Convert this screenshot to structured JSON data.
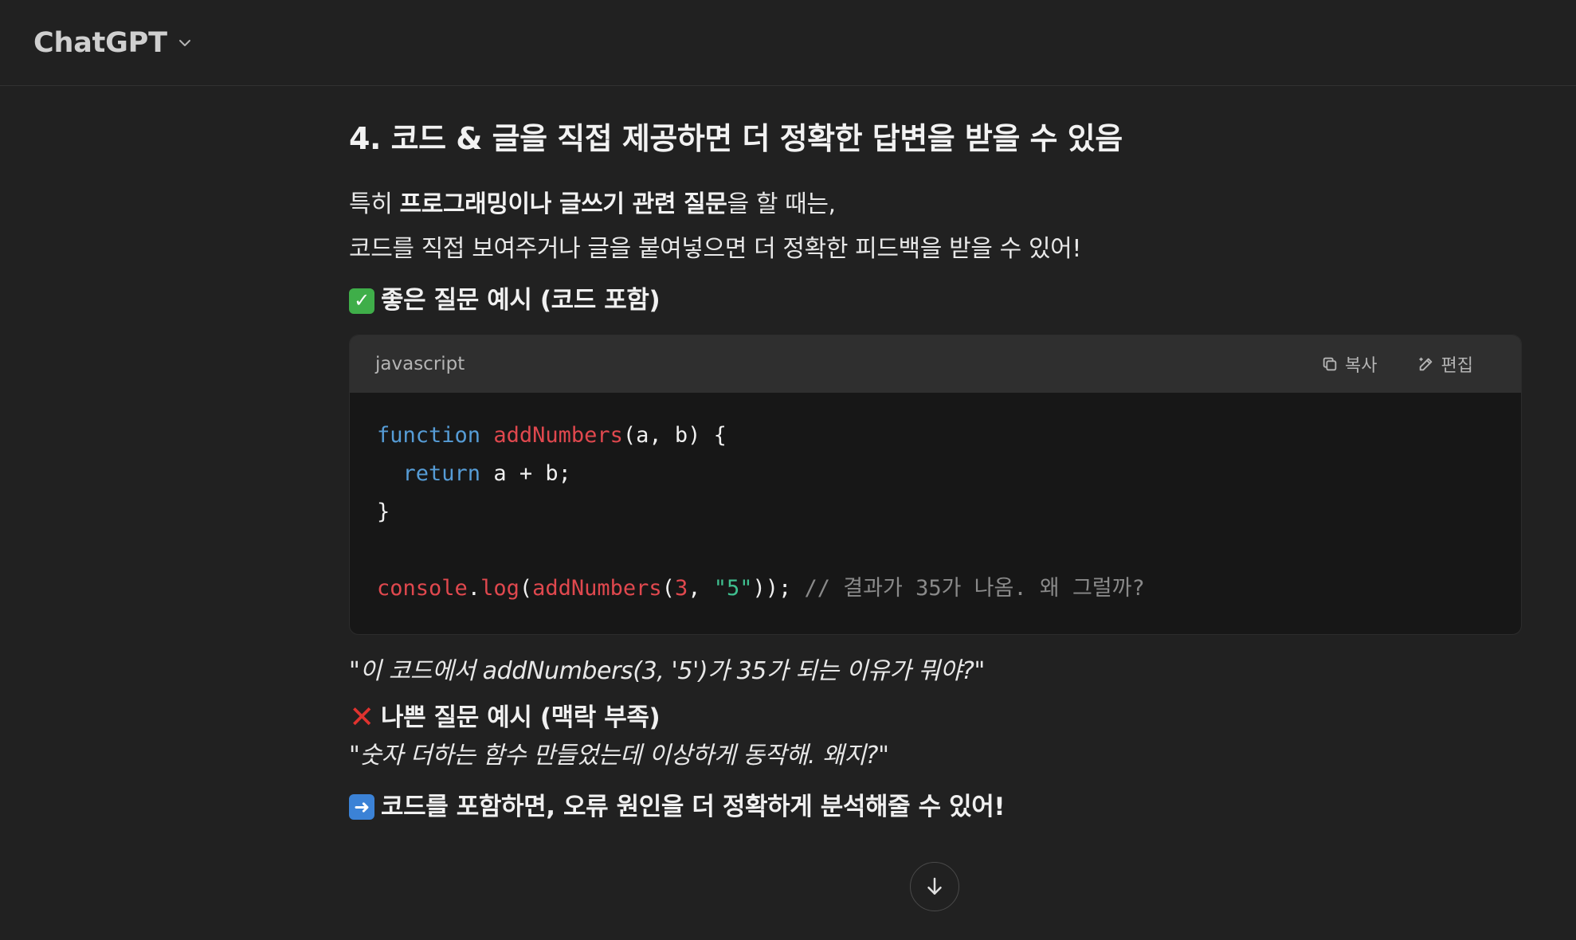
{
  "header": {
    "model_name": "ChatGPT"
  },
  "message": {
    "heading": "4. 코드 & 글을 직접 제공하면 더 정확한 답변을 받을 수 있음",
    "para_line1_prefix": "특히 ",
    "para_line1_bold": "프로그래밍이나 글쓰기 관련 질문",
    "para_line1_suffix": "을 할 때는,",
    "para_line2": "코드를 직접 보여주거나 글을 붙여넣으면 더 정확한 피드백을 받을 수 있어!",
    "good_example_icon": "✓",
    "good_example_label": "좋은 질문 예시 (코드 포함)",
    "good_quote": "\"이 코드에서 addNumbers(3, '5')가 35가 되는 이유가 뭐야?\"",
    "bad_example_icon": "✕",
    "bad_example_label": "나쁜 질문 예시 (맥락 부족)",
    "bad_quote": "\"숫자 더하는 함수 만들었는데 이상하게 동작해. 왜지?\"",
    "conclusion_icon": "➜",
    "conclusion": "코드를 포함하면, 오류 원인을 더 정확하게 분석해줄 수 있어!"
  },
  "codeblock": {
    "language": "javascript",
    "copy_label": "복사",
    "edit_label": "편집",
    "code": {
      "line1_kw": "function",
      "line1_fn": "addNumbers",
      "line1_rest": "(a, b) {",
      "line2_kw": "return",
      "line2_rest": " a + b;",
      "line3": "}",
      "line5_obj": "console",
      "line5_dot": ".",
      "line5_method": "log",
      "line5_p1": "(",
      "line5_fn": "addNumbers",
      "line5_p2": "(",
      "line5_num": "3",
      "line5_comma": ", ",
      "line5_str": "\"5\"",
      "line5_close": "));",
      "line5_comment": " // 결과가 35가 나옴. 왜 그럴까?"
    }
  },
  "icons": {
    "model_switch": "chevron-down-icon",
    "copy": "copy-icon",
    "edit": "edit-icon",
    "scroll": "arrow-down-icon"
  }
}
